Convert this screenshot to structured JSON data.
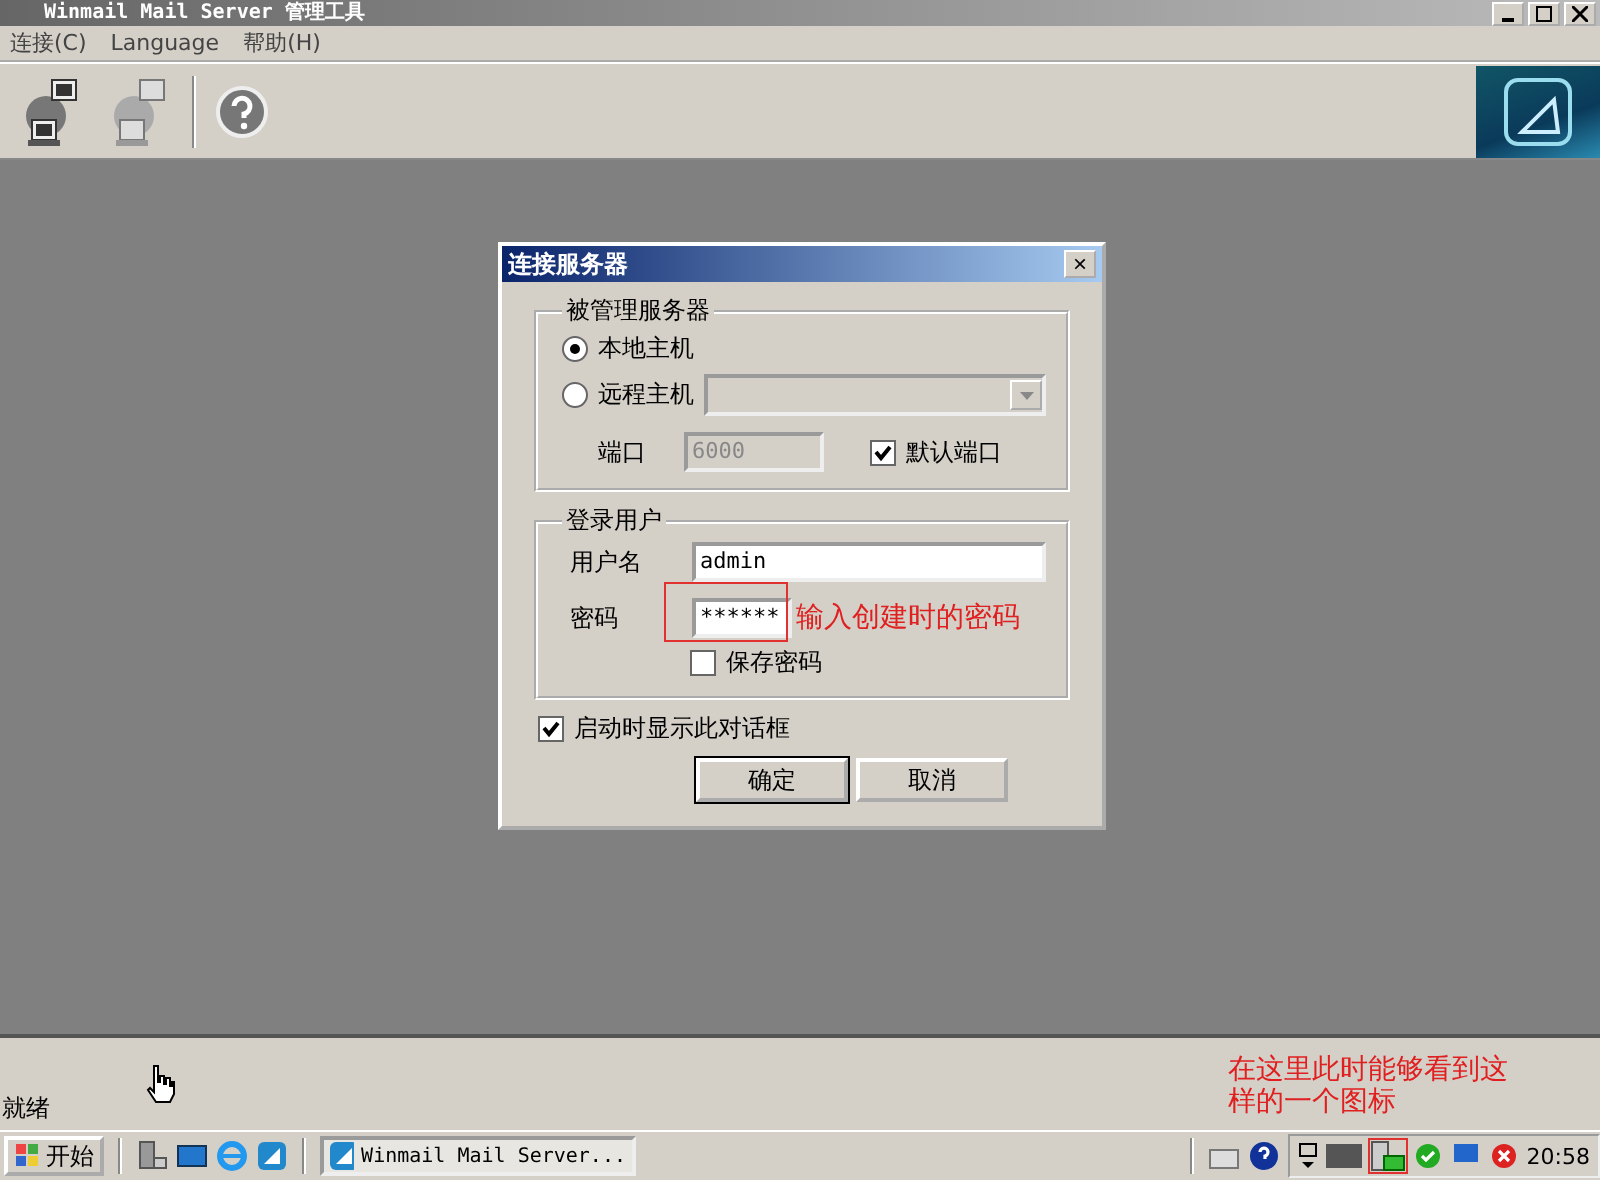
{
  "window": {
    "title": "Winmail Mail Server    管理工具"
  },
  "menu": [
    "连接(C)",
    "Language",
    "帮助(H)"
  ],
  "dialog": {
    "title": "连接服务器",
    "close": "×",
    "server_group": {
      "title": "被管理服务器",
      "options": [
        {
          "label": "本地主机",
          "selected": true
        },
        {
          "label": "远程主机",
          "selected": false
        }
      ],
      "remote_host": {
        "disabled": true
      },
      "port": {
        "label": "端口",
        "value": "6000",
        "disabled": true
      },
      "default_port": {
        "label": "默认端口",
        "checked": true
      }
    },
    "login_group": {
      "title": "登录用户",
      "username": {
        "label": "用户名",
        "value": "admin"
      },
      "password": {
        "label": "密码",
        "value": "******"
      },
      "save_password": {
        "label": "保存密码",
        "checked": false
      }
    },
    "show_on_start": {
      "label": "启动时显示此对话框",
      "checked": true
    },
    "buttons": [
      {
        "label": "确定",
        "default": true
      },
      {
        "label": "取消",
        "default": false
      }
    ]
  },
  "annotations": [
    {
      "kind": "inline",
      "text": "输入创建时的密码"
    },
    {
      "kind": "corner",
      "lines": [
        "在这里此时能够看到这",
        "样的一个图标"
      ]
    }
  ],
  "status_bar": {
    "text": "就绪"
  },
  "taskbar": {
    "start": "开始",
    "task": "Winmail Mail Server...",
    "clock": "20:58"
  }
}
